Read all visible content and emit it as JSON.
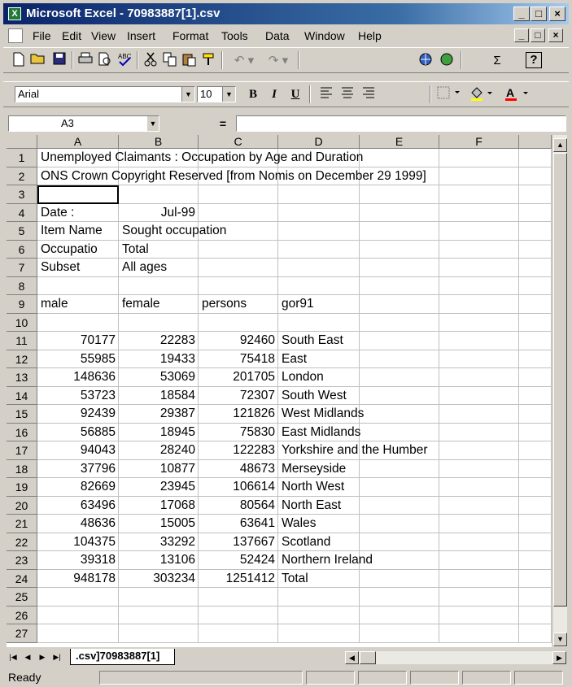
{
  "window": {
    "title": "Microsoft Excel - 70983887[1].csv",
    "minimize_glyph": "_",
    "restore_glyph": "□",
    "close_glyph": "×"
  },
  "menu": [
    "File",
    "Edit",
    "View",
    "Insert",
    "Format",
    "Tools",
    "Data",
    "Window",
    "Help"
  ],
  "doc_controls": {
    "minimize": "_",
    "restore": "□",
    "close": "×"
  },
  "toolbar": {
    "icons": [
      "new-icon",
      "open-icon",
      "save-icon",
      "print-icon",
      "print-preview-icon",
      "spelling-icon",
      "cut-icon",
      "copy-icon",
      "paste-icon",
      "format-painter-icon",
      "undo-icon",
      "redo-icon",
      "insert-hyperlink-icon",
      "web-toolbar-icon",
      "autosum-icon",
      "help-icon"
    ],
    "autosum_glyph": "Σ",
    "help_glyph": "?"
  },
  "format": {
    "font": "Arial",
    "size": "10",
    "bold": "B",
    "italic": "I",
    "underline": "U"
  },
  "formula_bar": {
    "name_box": "A3",
    "equals": "=",
    "content": ""
  },
  "columns": [
    "A",
    "B",
    "C",
    "D",
    "E",
    "F"
  ],
  "rows": [
    {
      "n": "1",
      "A": "Unemployed Claimants : Occupation by Age and Duration",
      "B": "",
      "C": "",
      "D": ""
    },
    {
      "n": "2",
      "A": "ONS Crown Copyright Reserved [from Nomis on December 29 1999]",
      "B": "",
      "C": "",
      "D": ""
    },
    {
      "n": "3",
      "A": "",
      "B": "",
      "C": "",
      "D": ""
    },
    {
      "n": "4",
      "A": "Date         :",
      "B": "Jul-99",
      "C": "",
      "D": ""
    },
    {
      "n": "5",
      "A": "Item Name",
      "B": "Sought occupation",
      "C": "",
      "D": ""
    },
    {
      "n": "6",
      "A": "Occupatio",
      "B": "Total",
      "C": "",
      "D": ""
    },
    {
      "n": "7",
      "A": "Subset",
      "B": "All ages",
      "C": "",
      "D": ""
    },
    {
      "n": "8",
      "A": "",
      "B": "",
      "C": "",
      "D": ""
    },
    {
      "n": "9",
      "A": "male",
      "B": "female",
      "C": "persons",
      "D": "gor91"
    },
    {
      "n": "10",
      "A": "",
      "B": "",
      "C": "",
      "D": ""
    },
    {
      "n": "11",
      "A": "70177",
      "B": "22283",
      "C": "92460",
      "D": "South East"
    },
    {
      "n": "12",
      "A": "55985",
      "B": "19433",
      "C": "75418",
      "D": "East"
    },
    {
      "n": "13",
      "A": "148636",
      "B": "53069",
      "C": "201705",
      "D": "London"
    },
    {
      "n": "14",
      "A": "53723",
      "B": "18584",
      "C": "72307",
      "D": "South West"
    },
    {
      "n": "15",
      "A": "92439",
      "B": "29387",
      "C": "121826",
      "D": "West Midlands"
    },
    {
      "n": "16",
      "A": "56885",
      "B": "18945",
      "C": "75830",
      "D": "East Midlands"
    },
    {
      "n": "17",
      "A": "94043",
      "B": "28240",
      "C": "122283",
      "D": "Yorkshire and the Humber"
    },
    {
      "n": "18",
      "A": "37796",
      "B": "10877",
      "C": "48673",
      "D": "Merseyside"
    },
    {
      "n": "19",
      "A": "82669",
      "B": "23945",
      "C": "106614",
      "D": "North West"
    },
    {
      "n": "20",
      "A": "63496",
      "B": "17068",
      "C": "80564",
      "D": "North East"
    },
    {
      "n": "21",
      "A": "48636",
      "B": "15005",
      "C": "63641",
      "D": "Wales"
    },
    {
      "n": "22",
      "A": "104375",
      "B": "33292",
      "C": "137667",
      "D": "Scotland"
    },
    {
      "n": "23",
      "A": "39318",
      "B": "13106",
      "C": "52424",
      "D": "Northern Ireland"
    },
    {
      "n": "24",
      "A": "948178",
      "B": "303234",
      "C": "1251412",
      "D": "Total"
    },
    {
      "n": "25",
      "A": "",
      "B": "",
      "C": "",
      "D": ""
    },
    {
      "n": "26",
      "A": "",
      "B": "",
      "C": "",
      "D": ""
    },
    {
      "n": "27",
      "A": "",
      "B": "",
      "C": "",
      "D": ""
    }
  ],
  "sheet_tab": ".csv]70983887[1]",
  "status": "Ready",
  "colors": {
    "title_bar": "#0a246a",
    "chrome": "#d4d0c8",
    "grid_line": "#c0c0c0"
  }
}
